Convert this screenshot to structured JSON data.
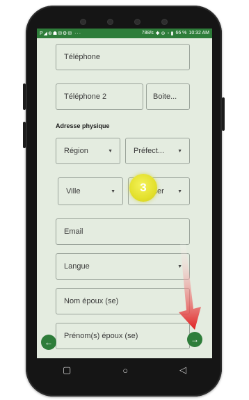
{
  "status_bar": {
    "left_icons": "P◢⊕☗✉⚙✉ ···",
    "speed": "788/s",
    "right_icons": "✱ ⊖ ◔ ▮",
    "battery": "66 %",
    "time": "10:32 AM"
  },
  "form": {
    "telephone_placeholder": "Téléphone",
    "telephone2_placeholder": "Téléphone 2",
    "boite_placeholder": "Boite...",
    "section_title": "Adresse physique",
    "region_label": "Région",
    "prefecture_label": "Préfect...",
    "ville_label": "Ville",
    "quartier_label": "Quartier",
    "email_placeholder": "Email",
    "langue_label": "Langue",
    "nom_epoux_placeholder": "Nom époux (se)",
    "prenom_epoux_placeholder": "Prénom(s) époux (se)"
  },
  "annotation": {
    "step_number": "3",
    "badge_color": "#e6e33a",
    "arrow_color": "#e02020"
  },
  "colors": {
    "brand_green": "#2e7d3a",
    "screen_bg": "#e4ece0"
  },
  "icons": {
    "prev": "arrow-left-icon",
    "next": "arrow-right-icon",
    "dropdown": "caret-down-icon",
    "nav_recents": "square-icon",
    "nav_home": "circle-icon",
    "nav_back": "triangle-icon"
  }
}
